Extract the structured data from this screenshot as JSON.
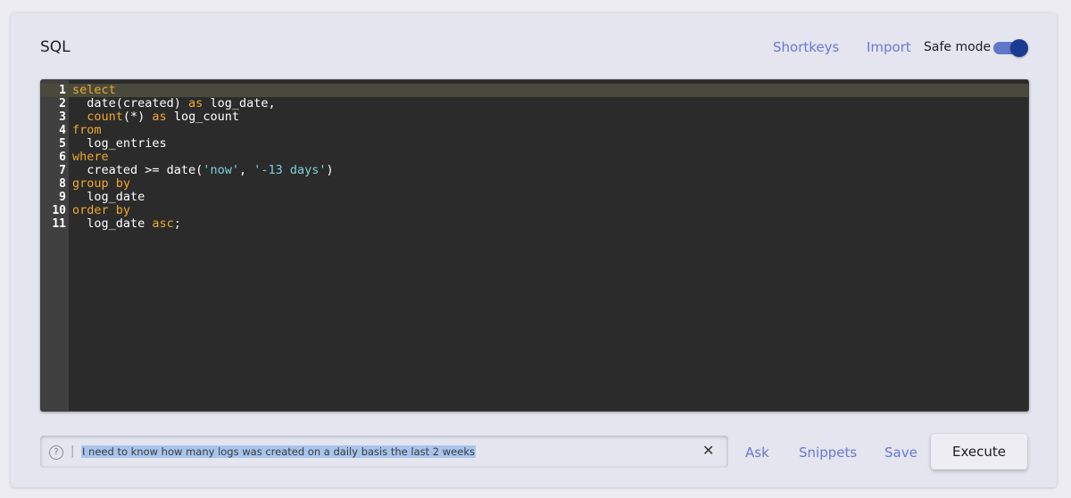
{
  "header": {
    "title": "SQL",
    "shortkeys_label": "Shortkeys",
    "import_label": "Import",
    "safe_mode_label": "Safe mode",
    "safe_mode_on": true
  },
  "editor": {
    "lines": [
      {
        "n": "1",
        "text": "select"
      },
      {
        "n": "2",
        "text": "  date(created) as log_date,"
      },
      {
        "n": "3",
        "text": "  count(*) as log_count"
      },
      {
        "n": "4",
        "text": "from"
      },
      {
        "n": "5",
        "text": "  log_entries"
      },
      {
        "n": "6",
        "text": "where"
      },
      {
        "n": "7",
        "text": "  created >= date('now', '-13 days')"
      },
      {
        "n": "8",
        "text": "group by"
      },
      {
        "n": "9",
        "text": "  log_date"
      },
      {
        "n": "10",
        "text": "order by"
      },
      {
        "n": "11",
        "text": "  log_date asc;"
      }
    ]
  },
  "assistant": {
    "help_icon": "question-circle-icon",
    "prompt_text": "I need to know how many logs was created on a daily basis the last 2 weeks",
    "clear_icon": "close-icon"
  },
  "actions": {
    "ask_label": "Ask",
    "snippets_label": "Snippets",
    "save_label": "Save",
    "execute_label": "Execute"
  },
  "colors": {
    "accent": "#6877d8",
    "keyword": "#f0a92e",
    "string": "#7dd2dd",
    "editor_bg": "#2b2b2b",
    "toggle": "#1b3a92"
  }
}
